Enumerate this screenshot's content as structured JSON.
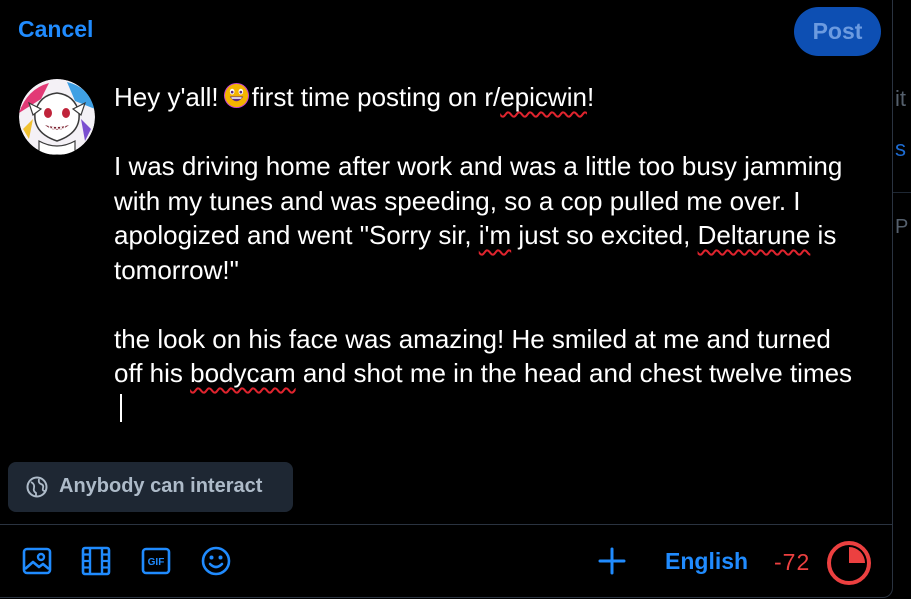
{
  "header": {
    "cancel_label": "Cancel",
    "post_label": "Post"
  },
  "author": {
    "avatar_icon": "character-avatar"
  },
  "post": {
    "line1_start": "Hey y'all!",
    "line1_emoji": "grinning-face-emoji",
    "line1_mid": "first time posting on r/",
    "line1_spell": "epicwin",
    "line1_end": "!",
    "p2_before": "I was driving home after work and was a little too busy jamming with my tunes and was speeding, so a cop pulled me over. I apologized and went \"Sorry sir, ",
    "p2_spell1": "i'm",
    "p2_mid": " just so excited, ",
    "p2_spell2": "Deltarune",
    "p2_after": " is tomorrow!\"",
    "p3_before": "the look on his face was amazing! He smiled at me and turned off his ",
    "p3_spell": "bodycam",
    "p3_after": " and shot me in the head and chest twelve times"
  },
  "interaction": {
    "label": "Anybody can interact",
    "icon": "globe-icon"
  },
  "toolbar": {
    "tools": [
      "image-icon",
      "video-icon",
      "gif-icon",
      "emoji-icon"
    ],
    "gif_text": "GIF",
    "add_icon": "plus-icon",
    "language": "English",
    "char_count": "-72",
    "char_limit_ratio": 1.0,
    "over_limit_color": "#ec4040"
  },
  "colors": {
    "accent": "#208bfe",
    "post_button_bg": "#0d4fb3",
    "post_button_text": "#6c9be0",
    "pill_bg": "#1e2733",
    "spell_underline": "#e0242e"
  }
}
